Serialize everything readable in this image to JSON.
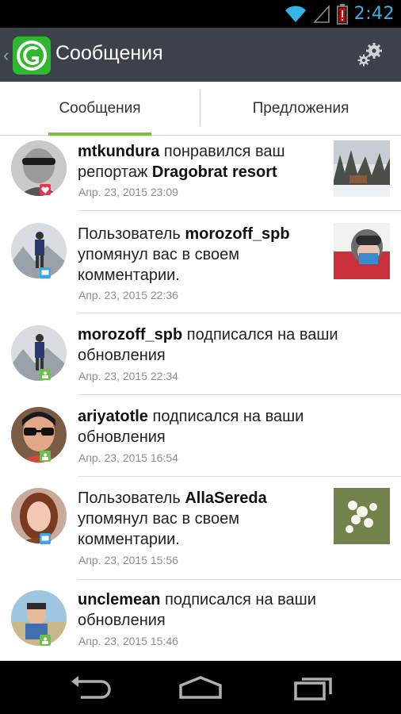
{
  "status_bar": {
    "time": "2:42"
  },
  "action_bar": {
    "title": "Сообщения"
  },
  "tabs": [
    {
      "label": "Сообщения",
      "selected": true
    },
    {
      "label": "Предложения",
      "selected": false
    }
  ],
  "feed": [
    {
      "user": "mtkundura",
      "action": " понравился ваш репортаж ",
      "target": "Dragobrat resort",
      "time": "Апр. 23, 2015 23:09",
      "badge": "heart-icon"
    },
    {
      "prefix": "Пользователь ",
      "user": "morozoff_spb",
      "action": " упомянул вас в своем комментарии.",
      "time": "Апр. 23, 2015 22:36",
      "badge": "comment-icon"
    },
    {
      "user": "morozoff_spb",
      "action": " подписался на ваши обновления",
      "time": "Апр. 23, 2015 22:34",
      "badge": "follow-icon"
    },
    {
      "user": "ariyatotle",
      "action": " подписался на ваши обновления",
      "time": "Апр. 23, 2015 16:54",
      "badge": "follow-icon"
    },
    {
      "prefix": "Пользователь ",
      "user": "AllaSereda",
      "action": " упомянул вас в своем комментарии.",
      "time": "Апр. 23, 2015 15:56",
      "badge": "comment-icon"
    },
    {
      "user": "unclemean",
      "action": " подписался на ваши обновления",
      "time": "Апр. 23, 2015 15:46",
      "badge": "follow-icon"
    }
  ],
  "colors": {
    "accent_green": "#7cbf3f",
    "action_bar": "#3d4149",
    "status_time": "#33b5e5",
    "badge_red": "#e8344e",
    "badge_blue": "#3aa7e4",
    "badge_green": "#6cc04a"
  }
}
